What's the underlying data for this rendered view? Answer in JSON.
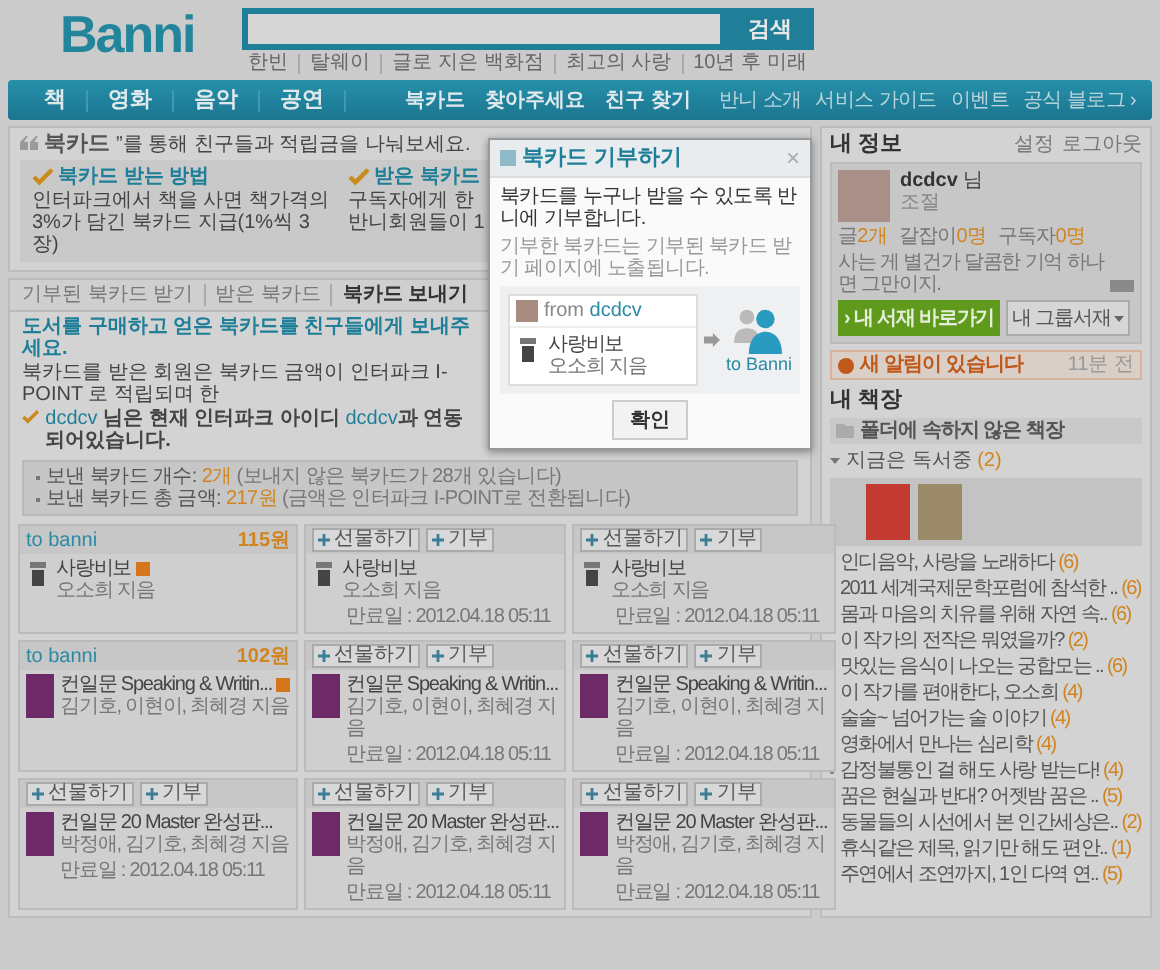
{
  "header": {
    "logo": "Banni",
    "search": {
      "button": "검색"
    },
    "links": [
      "한빈",
      "탈웨이",
      "글로 지은 백화점",
      "최고의 사랑",
      "10년 후 미래"
    ]
  },
  "nav": {
    "main": [
      "책",
      "영화",
      "음악",
      "공연"
    ],
    "features": [
      "북카드",
      "찾아주세요",
      "친구 찾기"
    ],
    "links": [
      "반니 소개",
      "서비스 가이드",
      "이벤트",
      "공식 블로그 ›"
    ]
  },
  "intro": {
    "title": "북카드",
    "subtitle": "”를 통해 친구들과 적립금을 나눠보세요.",
    "columns": [
      {
        "title": "북카드 받는 방법",
        "text": "인터파크에서 책을 사면 책가격의 3%가 담긴 북카드 지급(1%씩 3장)"
      },
      {
        "title": "받은 북카드",
        "text": "구독자에게 한 반니회원들이 1"
      }
    ]
  },
  "tabs": [
    {
      "label": "기부된 북카드 받기",
      "selected": false
    },
    {
      "label": "받은 북카드",
      "selected": false
    },
    {
      "label": "북카드 보내기",
      "selected": true
    }
  ],
  "send": {
    "headline": "도서를 구매하고 얻은 북카드를 친구들에게 보내주세요.",
    "description": "북카드를 받은 회원은 북카드 금액이 인터파크 I-POINT 로 적립되며 한",
    "link_notice": {
      "user": "dcdcv",
      "text": "님은 현재 인터파크 아이디",
      "id": "dcdcv",
      "rest": "과 연동되어있습니다."
    },
    "stats": [
      {
        "label": "보낸 북카드 개수:",
        "value": "2개",
        "note": "(보내지 않은 북카드가 28개 있습니다)"
      },
      {
        "label": "보낸 북카드 총 금액:",
        "value": "217원",
        "note": "(금액은 인터파크 I-POINT로 전환됩니다)"
      }
    ]
  },
  "cards": [
    {
      "kind": "received",
      "to": "to banni",
      "amount": "115원",
      "book": {
        "kind": "mini",
        "title": "사랑비보",
        "author": "오소희 지음"
      },
      "badge": true
    },
    {
      "kind": "sendable",
      "actions": [
        "선물하기",
        "기부"
      ],
      "book": {
        "kind": "mini",
        "title": "사랑비보",
        "author": "오소희 지음"
      },
      "badge": false,
      "expiry": "만료일 : 2012.04.18 05:11"
    },
    {
      "kind": "sendable",
      "actions": [
        "선물하기",
        "기부"
      ],
      "book": {
        "kind": "mini",
        "title": "사랑비보",
        "author": "오소희 지음"
      },
      "badge": false,
      "expiry": "만료일 : 2012.04.18 05:11"
    },
    {
      "kind": "received",
      "to": "to banni",
      "amount": "102원",
      "book": {
        "kind": "purple",
        "title": "컨일문 Speaking & Writin...",
        "author": "김기호, 이현이, 최혜경 지음"
      },
      "badge": true
    },
    {
      "kind": "sendable",
      "actions": [
        "선물하기",
        "기부"
      ],
      "book": {
        "kind": "purple",
        "title": "컨일문 Speaking & Writin...",
        "author": "김기호, 이현이, 최혜경 지음"
      },
      "badge": false,
      "expiry": "만료일 : 2012.04.18 05:11"
    },
    {
      "kind": "sendable",
      "actions": [
        "선물하기",
        "기부"
      ],
      "book": {
        "kind": "purple",
        "title": "컨일문 Speaking & Writin...",
        "author": "김기호, 이현이, 최혜경 지음"
      },
      "badge": false,
      "expiry": "만료일 : 2012.04.18 05:11"
    },
    {
      "kind": "sendable",
      "actions": [
        "선물하기",
        "기부"
      ],
      "book": {
        "kind": "purple",
        "title": "컨일문 20 Master 완성판...",
        "author": "박정애, 김기호, 최혜경 지음"
      },
      "badge": false,
      "expiry": "만료일 : 2012.04.18 05:11"
    },
    {
      "kind": "sendable",
      "actions": [
        "선물하기",
        "기부"
      ],
      "book": {
        "kind": "purple",
        "title": "컨일문 20 Master 완성판...",
        "author": "박정애, 김기호, 최혜경 지음"
      },
      "badge": false,
      "expiry": "만료일 : 2012.04.18 05:11"
    },
    {
      "kind": "sendable",
      "actions": [
        "선물하기",
        "기부"
      ],
      "book": {
        "kind": "purple",
        "title": "컨일문 20 Master 완성판...",
        "author": "박정애, 김기호, 최혜경 지음"
      },
      "badge": false,
      "expiry": "만료일 : 2012.04.18 05:11"
    }
  ],
  "my_info": {
    "title": "내 정보",
    "links": [
      "설정",
      "로그아웃"
    ],
    "name": "dcdcv",
    "honorific": "님",
    "grade": "조절",
    "stats": [
      {
        "label": "글",
        "value": "2개"
      },
      {
        "label": "갈잡이",
        "value": "0명"
      },
      {
        "label": "구독자",
        "value": "0명"
      }
    ],
    "quote": "사는 게 별건가 달콤한 기억 하나면 그만이지.",
    "primary_button": "› 내 서재 바로가기",
    "group_select": "내 그룹서재"
  },
  "alert": {
    "text": "새 알림이 있습니다",
    "time": "11분 전"
  },
  "shelf": {
    "title": "내 책장",
    "folder": "폴더에 속하지 않은 책장",
    "reading": {
      "label": "지금은 독서중",
      "count": "(2)"
    },
    "items": [
      {
        "title": "인디음악, 사랑을 노래하다",
        "count": "(6)"
      },
      {
        "title": "2011 세계국제문학포럼에 참석한 ..",
        "count": "(6)"
      },
      {
        "title": "몸과 마음의 치유를 위해 자연 속..",
        "count": "(6)"
      },
      {
        "title": "이 작가의 전작은 뭐였을까?",
        "count": "(2)"
      },
      {
        "title": "맛있는 음식이 나오는 궁합모는 ..",
        "count": "(6)"
      },
      {
        "title": "이 작가를 편애한다, 오소희",
        "count": "(4)"
      },
      {
        "title": "술술~ 넘어가는 술 이야기",
        "count": "(4)"
      },
      {
        "title": "영화에서 만나는 심리학",
        "count": "(4)"
      },
      {
        "title": "감정불통인 걸 해도 사랑 받는다!",
        "count": "(4)"
      },
      {
        "title": "꿈은 현실과 반대? 어젯밤 꿈은 ..",
        "count": "(5)"
      },
      {
        "title": "동물들의 시선에서 본 인간세상은..",
        "count": "(2)"
      },
      {
        "title": "휴식같은 제목, 읽기만 해도 편안..",
        "count": "(1)"
      },
      {
        "title": "주연에서 조연까지, 1인 다역 연..",
        "count": "(5)"
      }
    ]
  },
  "modal": {
    "title": "북카드 기부하기",
    "close": "×",
    "message": "북카드를 누구나 받을 수 있도록 반니에 기부합니다.",
    "hint": "기부한 북카드는 기부된 북카드 받기 페이지에 노출됩니다.",
    "from_label": "from",
    "from_user": "dcdcv",
    "book_title": "사랑비보",
    "book_author": "오소희 지음",
    "to": "to Banni",
    "confirm": "확인"
  }
}
